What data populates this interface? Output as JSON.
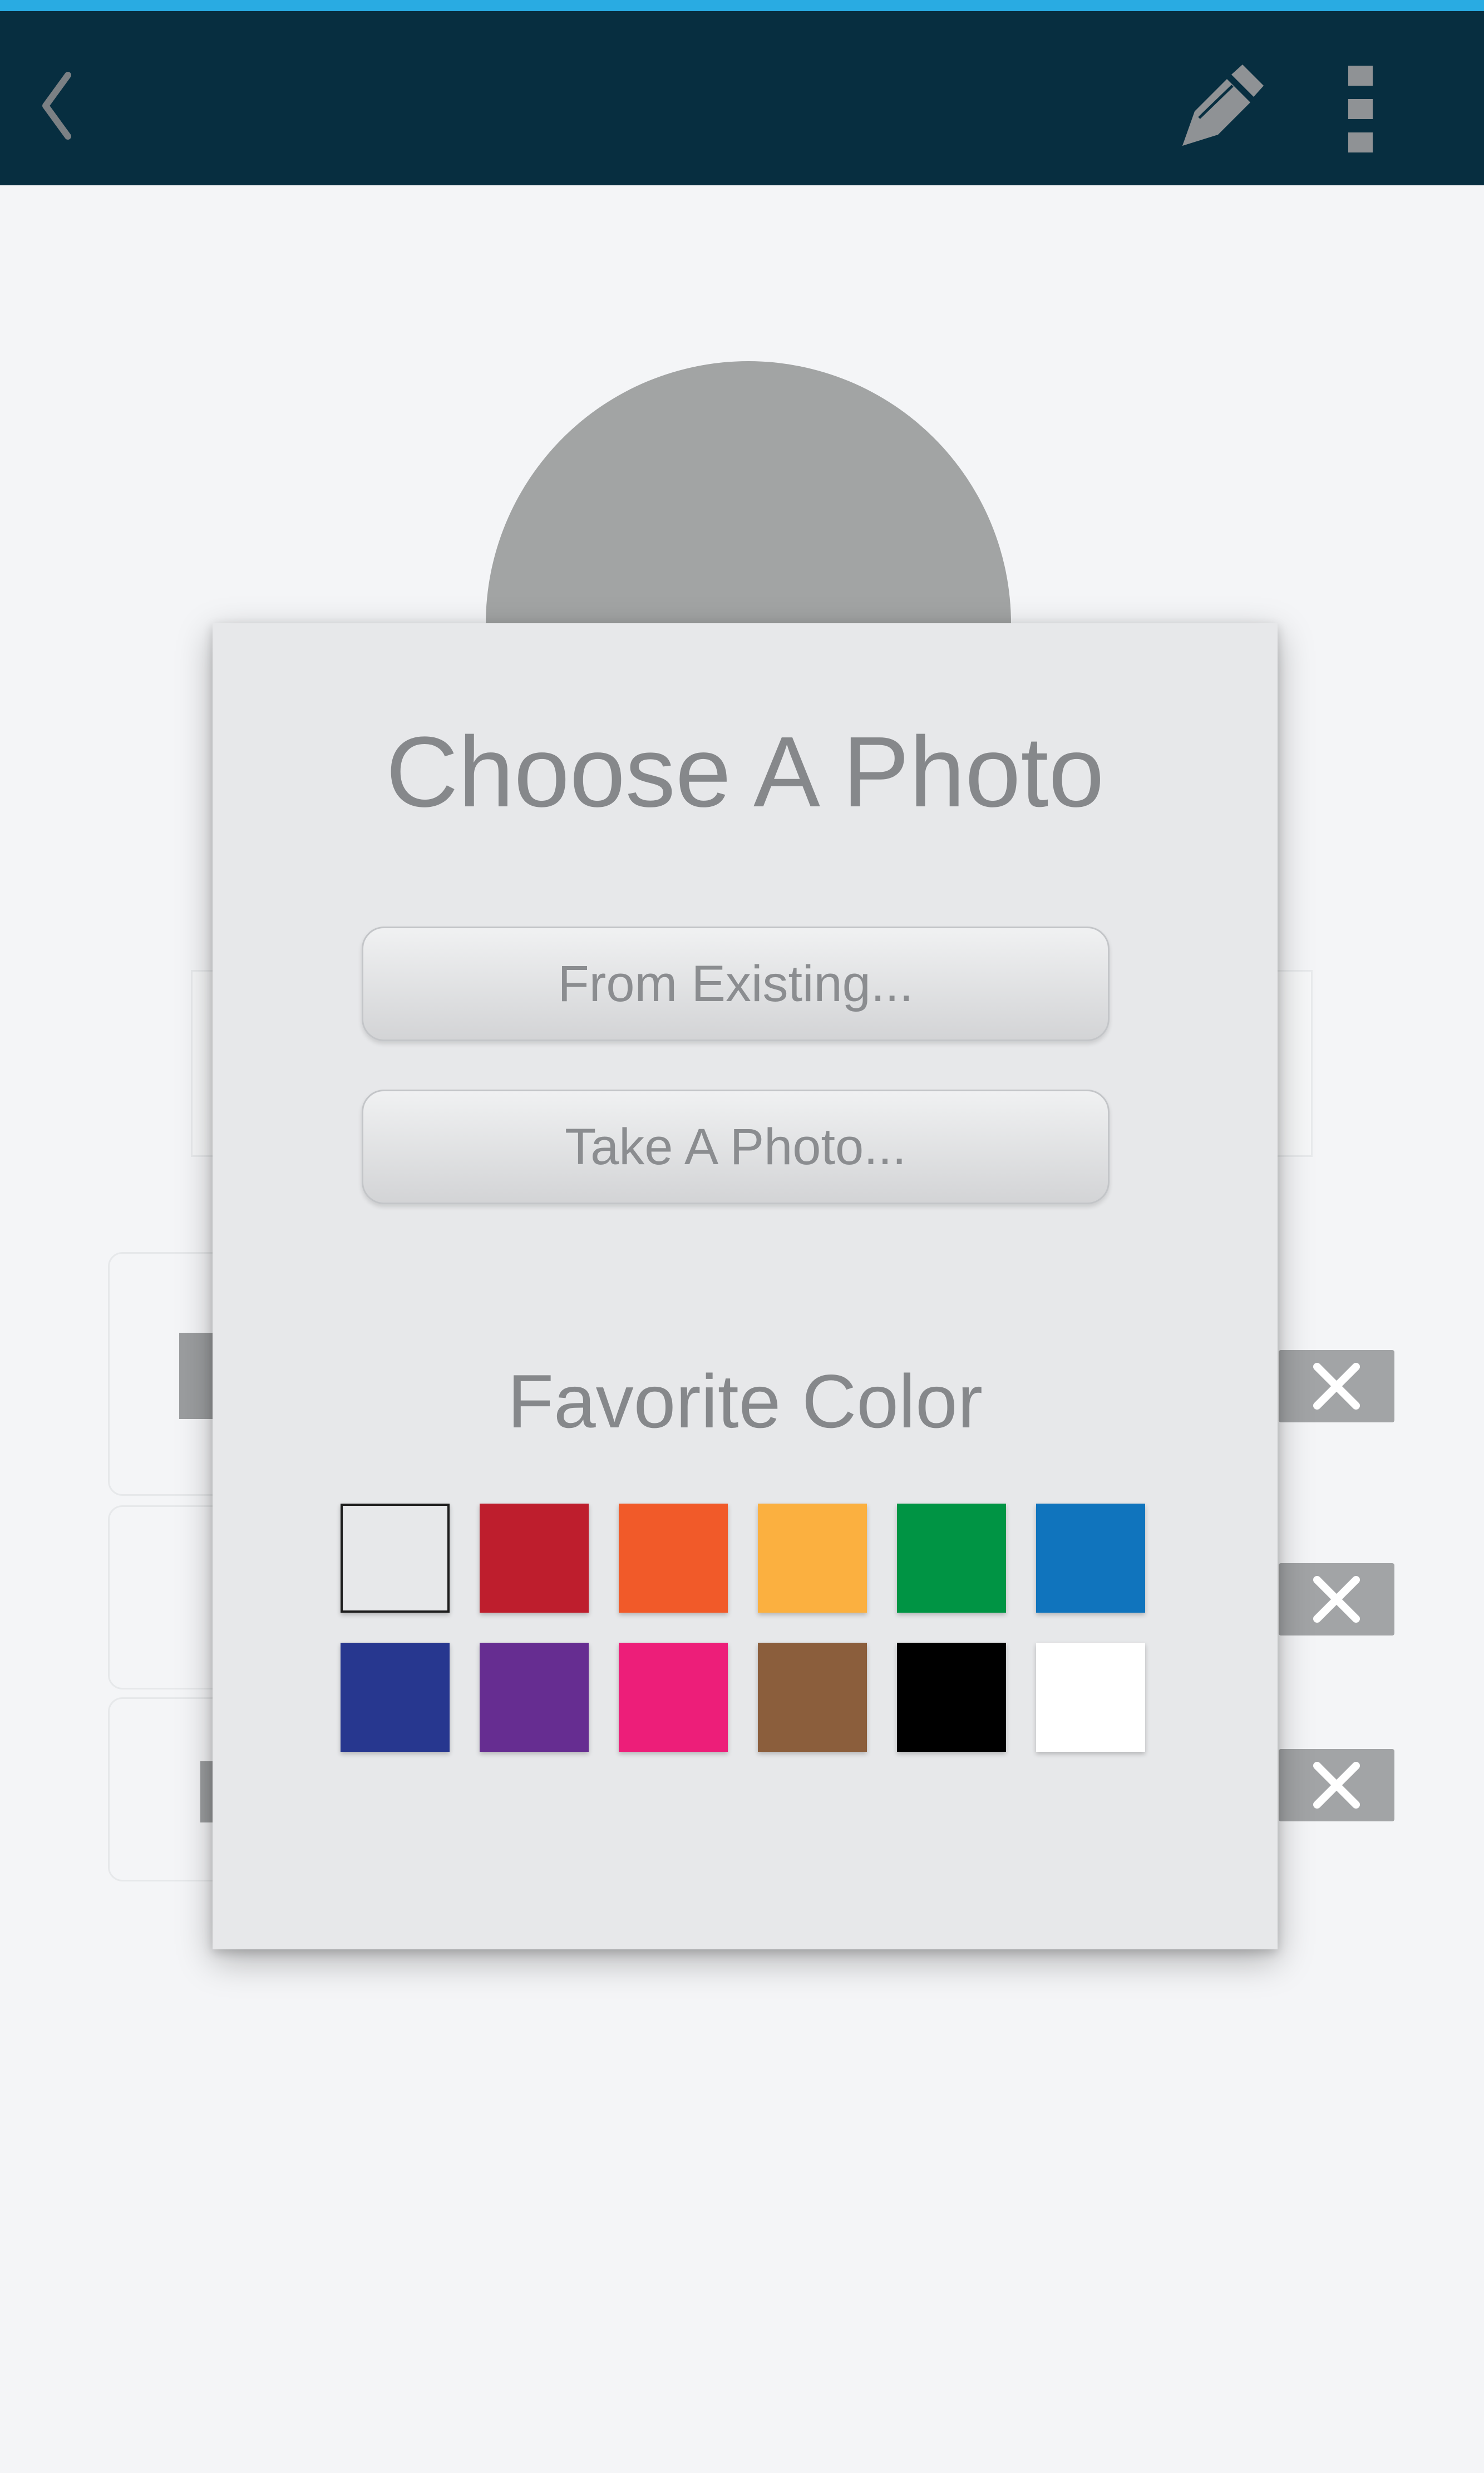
{
  "app_bar": {
    "back_icon": "chevron-left-icon",
    "edit_icon": "pencil-icon",
    "menu_icon": "more-vertical-icon",
    "background": "#072e40",
    "status_bar": "#29abe2"
  },
  "background": {
    "avatar_color": "#a2a4a4",
    "remove_icon": "close-icon"
  },
  "dialog": {
    "title": "Choose A Photo",
    "from_existing_label": "From Existing...",
    "take_photo_label": "Take A Photo...",
    "color_section_title": "Favorite Color",
    "selected_color": "#e7e8ea",
    "colors": [
      "#e7e8ea",
      "#be1e2d",
      "#f15a29",
      "#fbb040",
      "#009444",
      "#1074bd",
      "#27378f",
      "#662d91",
      "#ed1e79",
      "#8b5e3c",
      "#000000",
      "#ffffff"
    ]
  }
}
